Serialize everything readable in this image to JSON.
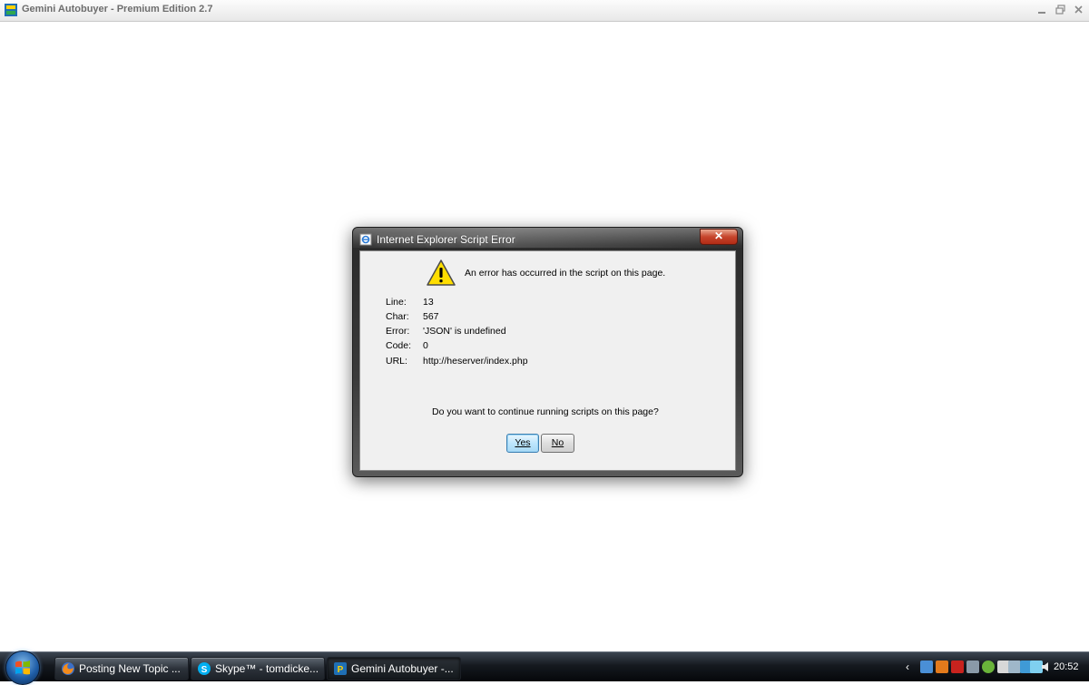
{
  "app": {
    "title": "Gemini Autobuyer - Premium Edition 2.7"
  },
  "dialog": {
    "title": "Internet Explorer Script Error",
    "close_glyph": "✕",
    "message": "An error has occurred in the script on this page.",
    "details": [
      {
        "label": "Line:",
        "value": "13"
      },
      {
        "label": "Char:",
        "value": "567"
      },
      {
        "label": "Error:",
        "value": "'JSON' is undefined"
      },
      {
        "label": "Code:",
        "value": "0"
      },
      {
        "label": "URL:",
        "value": "http://heserver/index.php"
      }
    ],
    "question": "Do you want to continue running scripts on this page?",
    "yes_label": "Yes",
    "no_label": "No"
  },
  "taskbar": {
    "items": [
      {
        "label": "Posting New Topic ...",
        "icon": "firefox-icon"
      },
      {
        "label": "Skype™ - tomdicke...",
        "icon": "skype-icon"
      },
      {
        "label": "Gemini Autobuyer -...",
        "icon": "gemini-app-icon"
      }
    ],
    "tray_chevron": "‹",
    "tray_icons": [
      "network-icon",
      "orange-app-icon",
      "acrobat-icon",
      "utility-icon",
      "green-app-icon",
      "printer-icon",
      "signal-icon",
      "monitor-icon",
      "wifi-icon",
      "volume-icon"
    ],
    "clock": "20:52"
  },
  "colors": {
    "dialog_frame": "#2b2b2b",
    "dialog_client": "#f0f0f0",
    "close_button": "#c6452c",
    "taskbar": "#15191f",
    "warning_yellow": "#ffde00"
  }
}
